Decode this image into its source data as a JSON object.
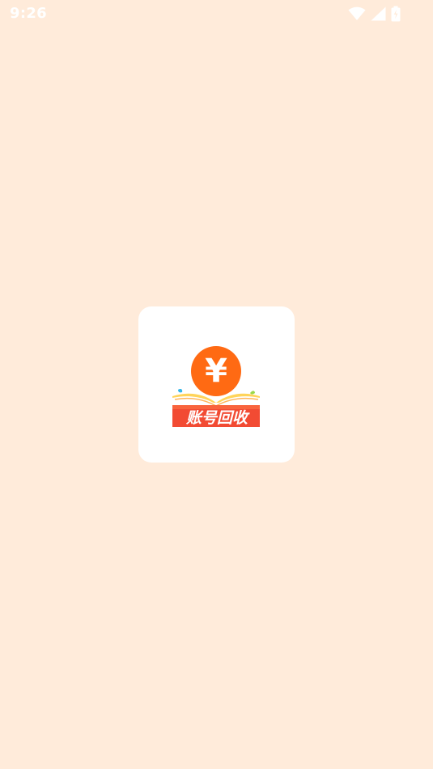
{
  "status_bar": {
    "time": "9:26",
    "icons": [
      "wifi-icon",
      "cellular-signal-icon",
      "battery-charging-icon"
    ]
  },
  "splash": {
    "logo": {
      "symbol": "¥",
      "text": "账号回收"
    }
  },
  "colors": {
    "background": "#FFEBDA",
    "card": "#FFFFFF",
    "brand_orange": "#FF6A13",
    "banner_red": "#F24B33",
    "status_fg": "#FFFFFF"
  }
}
